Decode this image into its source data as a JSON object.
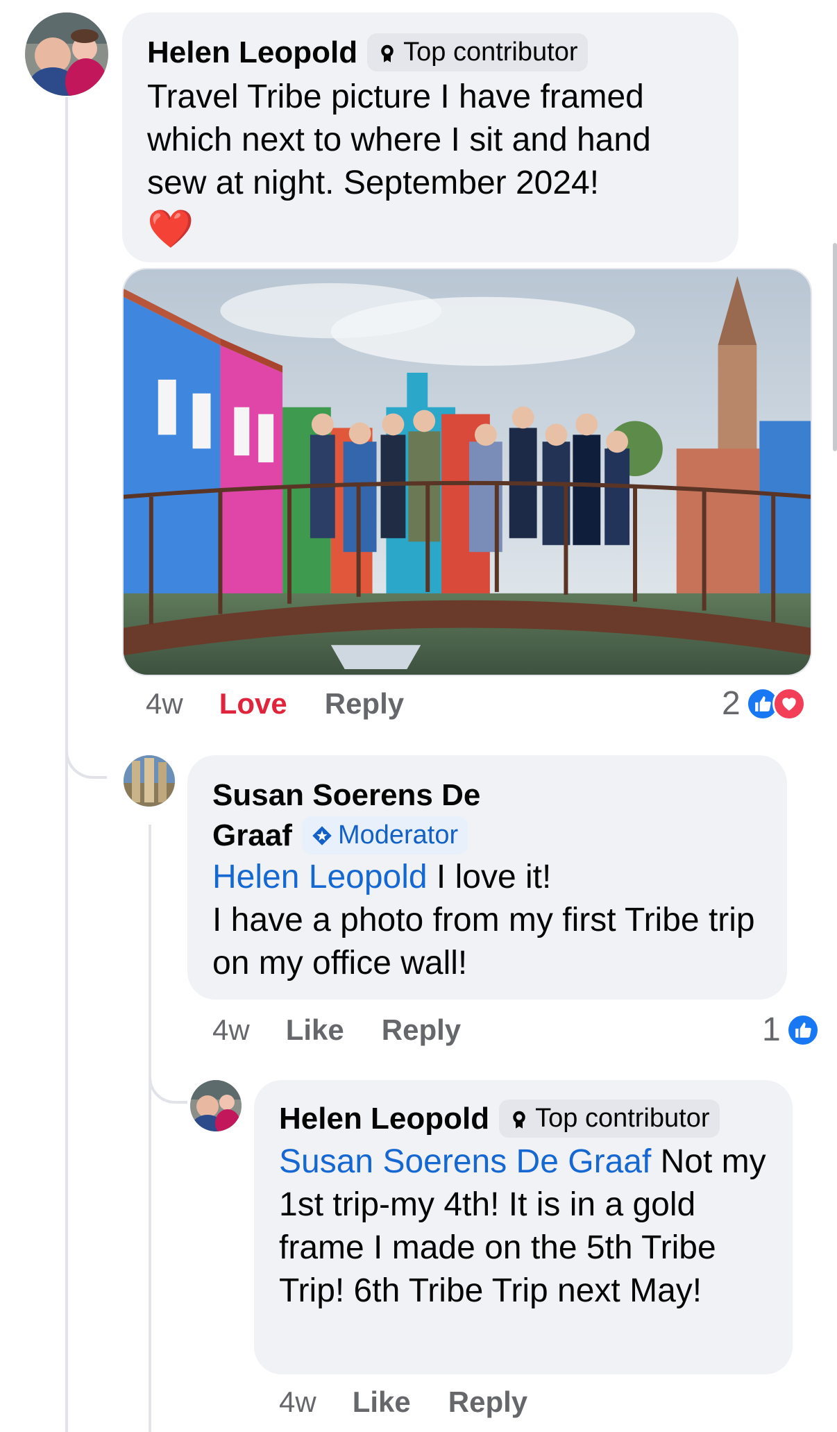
{
  "comments": [
    {
      "author": "Helen Leopold",
      "badge": "Top contributor",
      "text": "Travel Tribe picture I have framed which next to where I sit and hand sew at night. September 2024!",
      "emoji": "❤️",
      "time": "4w",
      "actions": {
        "primary": "Love",
        "reply": "Reply"
      },
      "reaction_count": "2",
      "reactions": [
        "like-icon",
        "love-icon"
      ]
    },
    {
      "author_line1": "Susan Soerens De",
      "author_line2": "Graaf",
      "badge": "Moderator",
      "mention": "Helen Leopold",
      "text_after_mention": " I love it!",
      "text_rest": "I have a photo from my first Tribe trip on my office wall!",
      "time": "4w",
      "actions": {
        "primary": "Like",
        "reply": "Reply"
      },
      "reaction_count": "1",
      "reactions": [
        "like-icon"
      ]
    },
    {
      "author": "Helen Leopold",
      "badge": "Top contributor",
      "mention": "Susan Soerens De Graaf",
      "text_after_mention": " Not my 1st trip-my 4th! It is in a gold frame I made on the 5th Tribe Trip! 6th Tribe Trip next May!",
      "time": "4w",
      "actions": {
        "primary": "Like",
        "reply": "Reply"
      }
    }
  ],
  "colors": {
    "bubble": "#f0f2f5",
    "mention": "#1567d2",
    "love": "#e0243b",
    "like": "#1877f2",
    "meta": "#65676b"
  }
}
